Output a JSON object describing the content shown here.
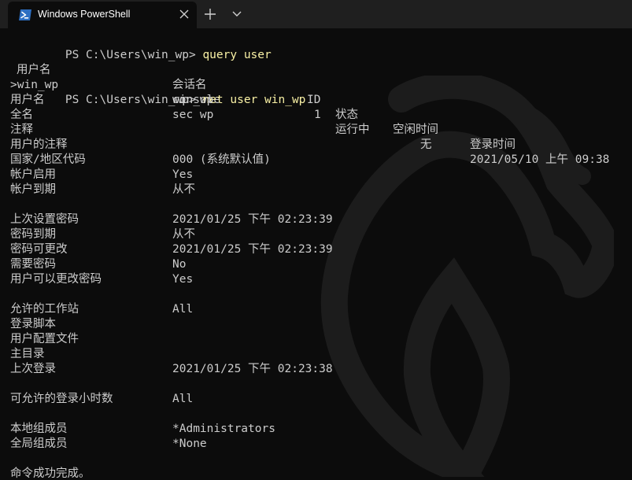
{
  "window": {
    "tab_title": "Windows PowerShell",
    "tab_icon": "powershell-icon",
    "close_icon": "close-icon",
    "new_tab_icon": "plus-icon",
    "dropdown_icon": "chevron-down-icon"
  },
  "colors": {
    "background": "#0c0c0c",
    "tabbar": "#1f1f1f",
    "text": "#cccccc",
    "command": "#f9f1a5",
    "powershell_blue": "#2d6fc2"
  },
  "terminal": {
    "prompt1": "PS C:\\Users\\win_wp> ",
    "cmd1": "query user",
    "query_headers": {
      "username": "用户名",
      "session": "会话名",
      "id": "ID",
      "state": "状态",
      "idle": "空闲时间",
      "logon": "登录时间"
    },
    "query_row": {
      "username": ">win_wp",
      "session": "console",
      "id": "1",
      "state": "运行中",
      "idle": "无",
      "logon": "2021/05/10 上午 09:38"
    },
    "prompt2": "PS C:\\Users\\win_wp> ",
    "cmd2": "net user win_wp",
    "net_user": [
      {
        "label": "用户名",
        "value": "win_wp"
      },
      {
        "label": "全名",
        "value": "sec wp"
      },
      {
        "label": "注释",
        "value": ""
      },
      {
        "label": "用户的注释",
        "value": ""
      },
      {
        "label": "国家/地区代码",
        "value": "000 (系统默认值)"
      },
      {
        "label": "帐户启用",
        "value": "Yes"
      },
      {
        "label": "帐户到期",
        "value": "从不"
      },
      {
        "label": "",
        "value": ""
      },
      {
        "label": "上次设置密码",
        "value": "2021/01/25 下午 02:23:39"
      },
      {
        "label": "密码到期",
        "value": "从不"
      },
      {
        "label": "密码可更改",
        "value": "2021/01/25 下午 02:23:39"
      },
      {
        "label": "需要密码",
        "value": "No"
      },
      {
        "label": "用户可以更改密码",
        "value": "Yes"
      },
      {
        "label": "",
        "value": ""
      },
      {
        "label": "允许的工作站",
        "value": "All"
      },
      {
        "label": "登录脚本",
        "value": ""
      },
      {
        "label": "用户配置文件",
        "value": ""
      },
      {
        "label": "主目录",
        "value": ""
      },
      {
        "label": "上次登录",
        "value": "2021/01/25 下午 02:23:38"
      },
      {
        "label": "",
        "value": ""
      },
      {
        "label": "可允许的登录小时数",
        "value": "All"
      },
      {
        "label": "",
        "value": ""
      },
      {
        "label": "本地组成员",
        "value": "*Administrators"
      },
      {
        "label": "全局组成员",
        "value": "*None"
      }
    ],
    "completion": "命令成功完成。"
  }
}
